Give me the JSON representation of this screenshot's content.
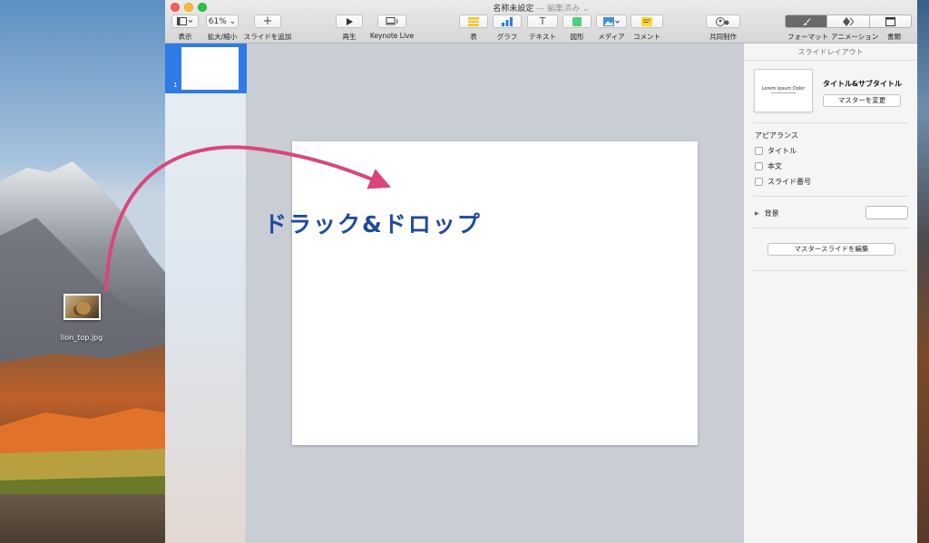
{
  "window": {
    "title": "名称未設定",
    "title_status": "— 編集済み ⌄"
  },
  "toolbar": {
    "view_label": "表示",
    "zoom_value": "61% ⌄",
    "zoom_label": "拡大/縮小",
    "add_slide_label": "スライドを追加",
    "play_label": "再生",
    "keynote_live_label": "Keynote Live",
    "table_label": "表",
    "chart_label": "グラフ",
    "text_label": "テキスト",
    "shape_label": "図形",
    "media_label": "メディア",
    "comment_label": "コメント",
    "collaborate_label": "共同制作",
    "format_label": "フォーマット",
    "animate_label": "アニメーション",
    "document_label": "書類"
  },
  "navigator": {
    "slides": [
      {
        "number": "1"
      }
    ]
  },
  "inspector": {
    "header": "スライドレイアウト",
    "preview_text": "Lorem Ipsum Dolor",
    "layout_name": "タイトル&サブタイトル",
    "change_master_label": "マスターを変更",
    "appearance_title": "アピアランス",
    "options": [
      {
        "label": "タイトル",
        "checked": false
      },
      {
        "label": "本文",
        "checked": false
      },
      {
        "label": "スライド番号",
        "checked": false
      }
    ],
    "background_label": "背景",
    "background_color": "#ffffff",
    "edit_master_label": "マスタースライドを編集"
  },
  "desktop": {
    "file_name": "lion_top.jpg"
  },
  "annotation": {
    "text": "ドラック&ドロップ",
    "arrow_color": "#d9477a",
    "text_color": "#1f4b9b"
  }
}
